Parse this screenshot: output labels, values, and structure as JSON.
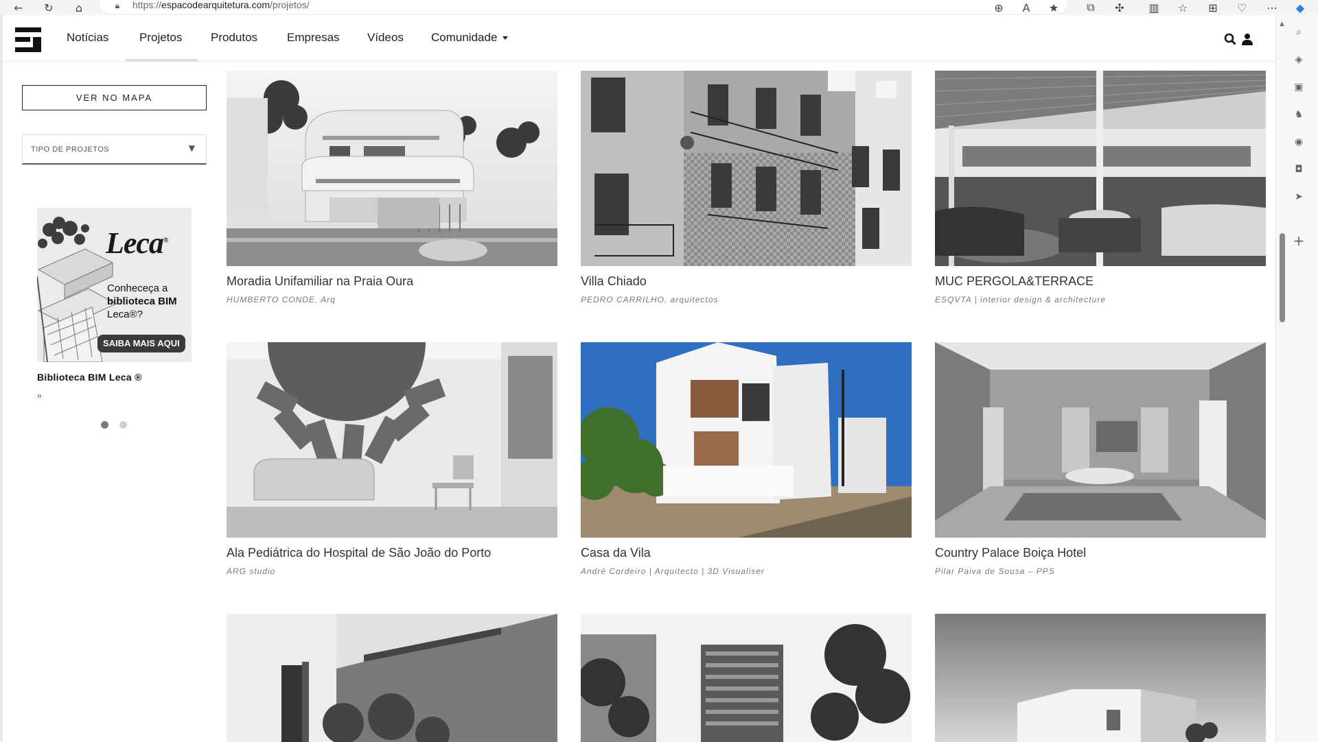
{
  "browser": {
    "url_prefix": "https://",
    "url_domain": "espacodearquitetura.com",
    "url_path": "/projetos/",
    "icons": [
      "back-icon",
      "reload-icon",
      "home-icon",
      "zoom-icon",
      "read-aloud-icon",
      "favorite-icon",
      "translate-icon",
      "extensions-icon",
      "split-screen-icon",
      "favorites-list-icon",
      "collections-icon",
      "browser-essentials-icon",
      "more-icon",
      "copilot-icon"
    ]
  },
  "edge_sidebar": {
    "icons": [
      "search-icon",
      "tag-icon",
      "briefcase-icon",
      "games-icon",
      "office-icon",
      "outlook-icon",
      "send-icon",
      "add-icon"
    ]
  },
  "header": {
    "nav": [
      {
        "label": "Notícias"
      },
      {
        "label": "Projetos",
        "active": true
      },
      {
        "label": "Produtos"
      },
      {
        "label": "Empresas"
      },
      {
        "label": "Vídeos"
      },
      {
        "label": "Comunidade",
        "dropdown": true
      }
    ],
    "icons": [
      "search-icon",
      "user-icon"
    ]
  },
  "sidebar": {
    "map_button": "VER NO MAPA",
    "type_select": "TIPO DE PROJETOS",
    "ad": {
      "brand": "Leca",
      "brand_mark": "®",
      "text_lines": [
        "Conheceça a",
        "biblioteca BIM",
        "Leca®?"
      ],
      "cta": "SAIBA MAIS AQUI",
      "title": "Biblioteca BIM Leca ®",
      "more": "»"
    },
    "carousel_dots": 2,
    "carousel_active": 0
  },
  "projects": [
    {
      "title": "Moradia Unifamiliar na Praia Oura",
      "author": "HUMBERTO CONDE, Arq"
    },
    {
      "title": "Villa Chiado",
      "author": "PEDRO CARRILHO, arquitectos"
    },
    {
      "title": "MUC PERGOLA&TERRACE",
      "author": "ESQVTA | interior design & architecture"
    },
    {
      "title": "Ala Pediátrica do Hospital de São João do Porto",
      "author": "ARG studio"
    },
    {
      "title": "Casa da Vila",
      "author": "André Cordeiro | Arquitecto | 3D Visualiser"
    },
    {
      "title": "Country Palace Boiça Hotel",
      "author": "Pilar Paiva de Sousa – PPS"
    },
    {
      "title": "",
      "author": ""
    },
    {
      "title": "",
      "author": ""
    },
    {
      "title": "",
      "author": ""
    }
  ],
  "colors": {
    "text": "#222222",
    "muted": "#777777",
    "border": "#dcdcdc",
    "accent_sky": "#2f6fc2"
  }
}
